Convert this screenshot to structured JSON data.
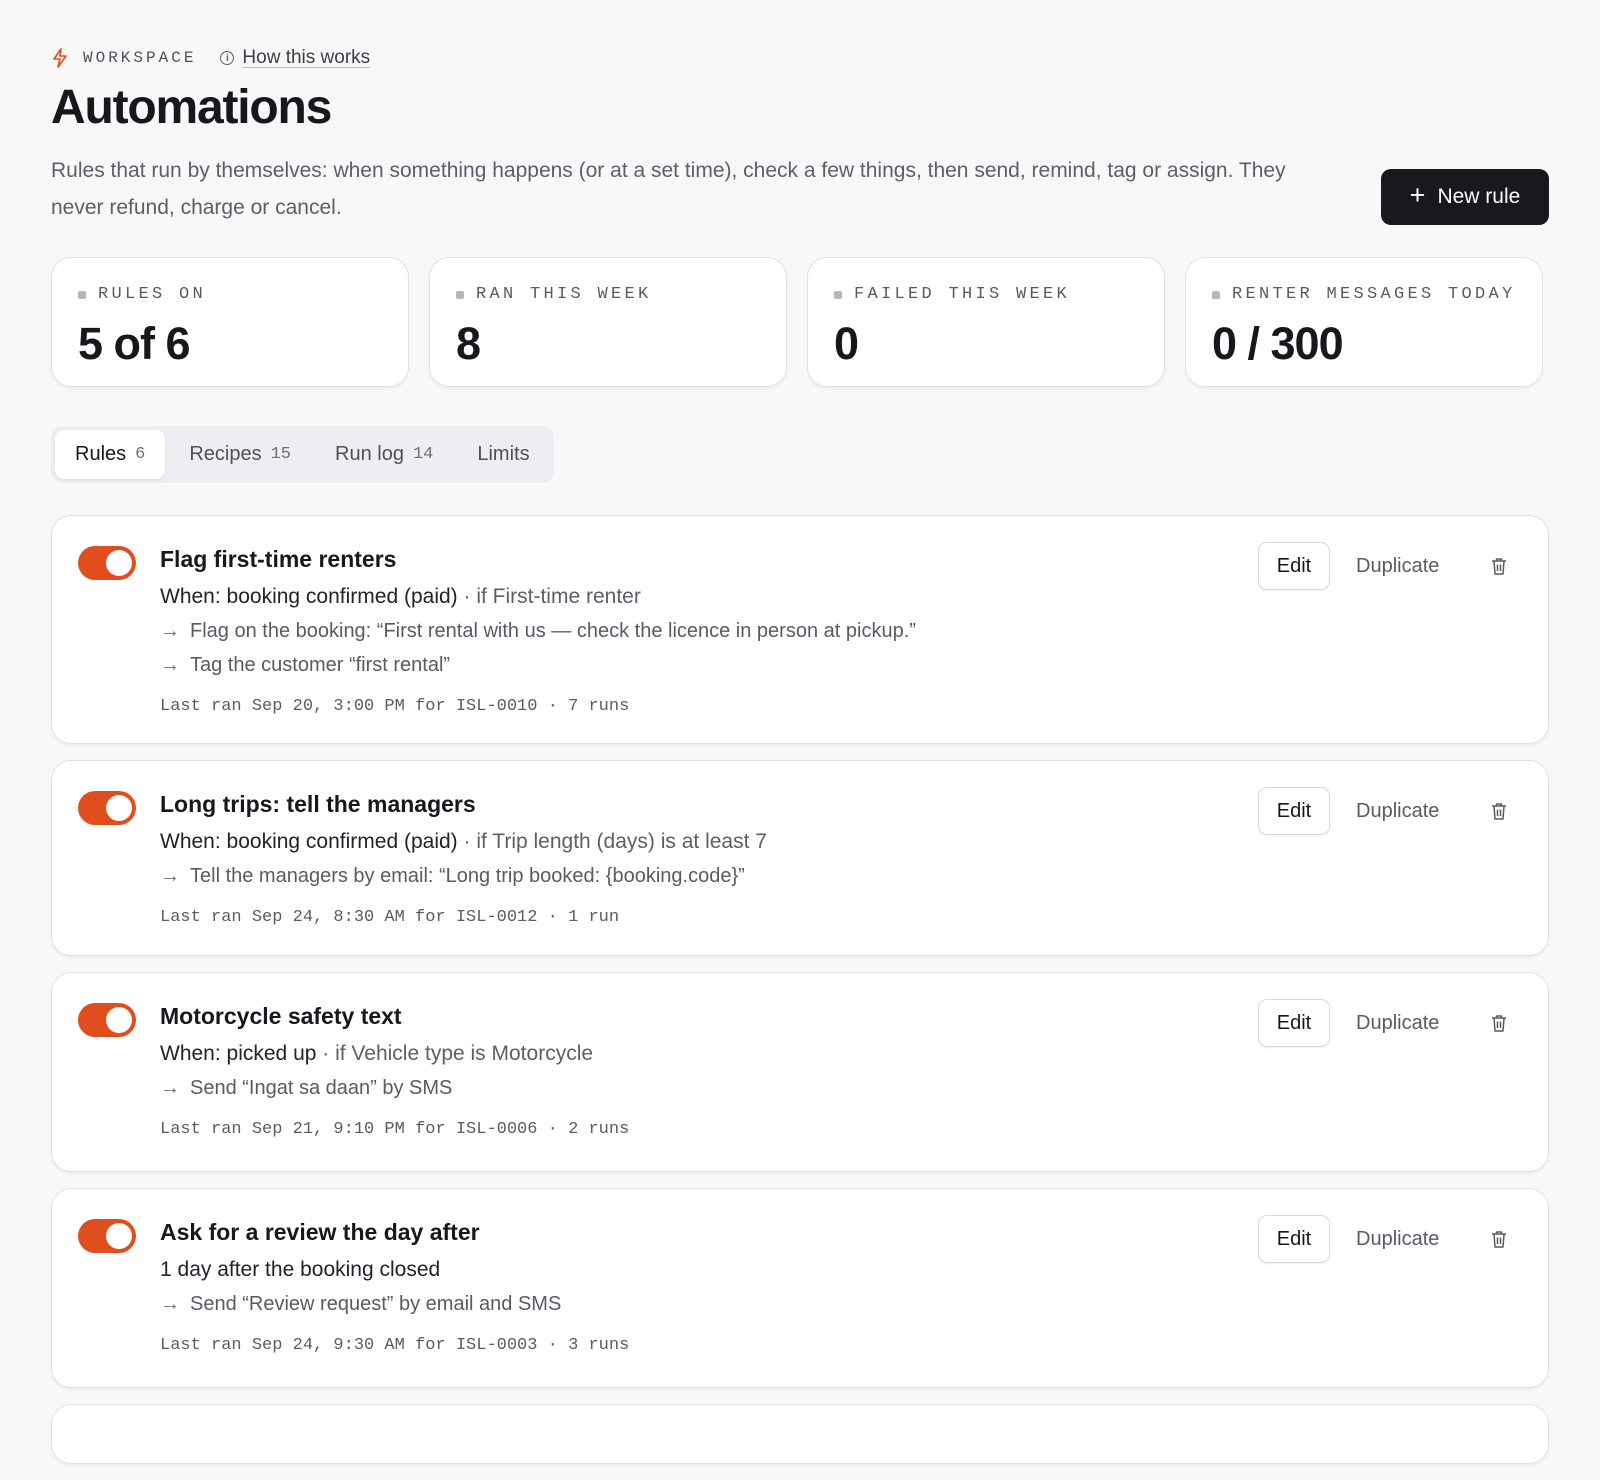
{
  "header": {
    "breadcrumb": "WORKSPACE",
    "help_link": "How this works",
    "title": "Automations",
    "description": "Rules that run by themselves: when something happens (or at a set time), check a few things, then send, remind, tag or assign. They never refund, charge or cancel.",
    "new_rule_label": "New rule"
  },
  "stats": [
    {
      "label": "RULES ON",
      "value": "5 of 6"
    },
    {
      "label": "RAN THIS WEEK",
      "value": "8"
    },
    {
      "label": "FAILED THIS WEEK",
      "value": "0"
    },
    {
      "label": "RENTER MESSAGES TODAY",
      "value": "0 / 300"
    }
  ],
  "tabs": [
    {
      "label": "Rules",
      "count": "6",
      "active": true
    },
    {
      "label": "Recipes",
      "count": "15",
      "active": false
    },
    {
      "label": "Run log",
      "count": "14",
      "active": false
    },
    {
      "label": "Limits",
      "count": "",
      "active": false
    }
  ],
  "rule_buttons": {
    "edit": "Edit",
    "duplicate": "Duplicate"
  },
  "rules": [
    {
      "enabled": true,
      "title": "Flag first-time renters",
      "trigger": "When: booking confirmed (paid)",
      "condition": " · if First-time renter",
      "actions": [
        "Flag on the booking: “First rental with us — check the licence in person at pickup.”",
        "Tag the customer “first rental”"
      ],
      "meta": "Last ran Sep 20, 3:00 PM for ISL-0010 · 7 runs"
    },
    {
      "enabled": true,
      "title": "Long trips: tell the managers",
      "trigger": "When: booking confirmed (paid)",
      "condition": " · if Trip length (days) is at least 7",
      "actions": [
        "Tell the managers by email: “Long trip booked: {booking.code}”"
      ],
      "meta": "Last ran Sep 24, 8:30 AM for ISL-0012 · 1 run"
    },
    {
      "enabled": true,
      "title": "Motorcycle safety text",
      "trigger": "When: picked up",
      "condition": " · if Vehicle type is Motorcycle",
      "actions": [
        "Send “Ingat sa daan” by SMS"
      ],
      "meta": "Last ran Sep 21, 9:10 PM for ISL-0006 · 2 runs"
    },
    {
      "enabled": true,
      "title": "Ask for a review the day after",
      "trigger": "1 day after the booking closed",
      "condition": "",
      "actions": [
        "Send “Review request” by email and SMS"
      ],
      "meta": "Last ran Sep 24, 9:30 AM for ISL-0003 · 3 runs"
    }
  ]
}
